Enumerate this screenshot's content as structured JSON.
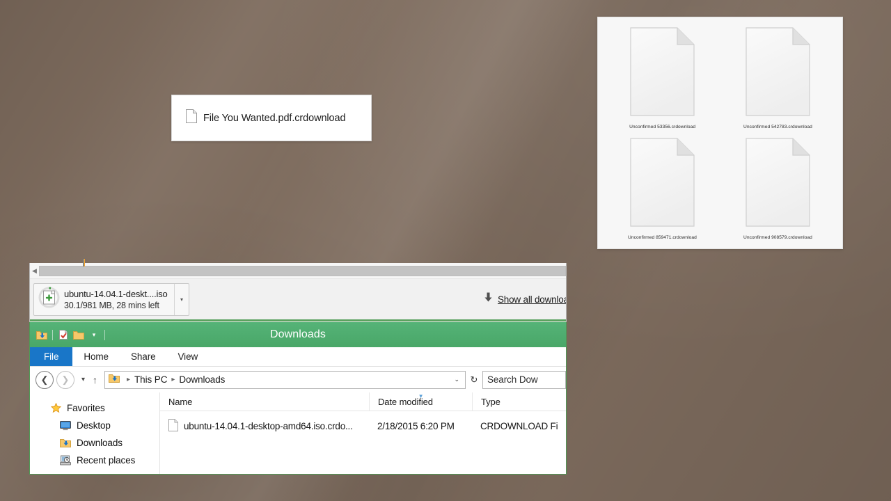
{
  "desktop": {
    "background_color": "#7d6b5d"
  },
  "file_card": {
    "icon": "document-icon",
    "label": "File You Wanted.pdf.crdownload"
  },
  "thumbnail_panel": {
    "items": [
      {
        "icon": "document-icon",
        "label": "Unconfirmed 53356.crdownload"
      },
      {
        "icon": "document-icon",
        "label": "Unconfirmed 542783.crdownload"
      },
      {
        "icon": "document-icon",
        "label": "Unconfirmed 859471.crdownload"
      },
      {
        "icon": "document-icon",
        "label": "Unconfirmed 908579.crdownload"
      }
    ]
  },
  "browser_shelf": {
    "download_item": {
      "icon": "download-progress-icon",
      "filename": "ubuntu-14.04.1-deskt....iso",
      "status": "30.1/981 MB, 28 mins left",
      "menu_caret": "▾"
    },
    "show_all": {
      "icon": "download-arrow-icon",
      "label": "Show all downloads"
    }
  },
  "explorer": {
    "title": "Downloads",
    "accent_color": "#4caf6d",
    "quick_access": [
      {
        "icon": "downloads-folder-icon"
      },
      {
        "icon": "properties-icon"
      },
      {
        "icon": "new-folder-icon"
      },
      {
        "icon": "customize-caret-icon",
        "label": "▾"
      }
    ],
    "ribbon_tabs": [
      {
        "label": "File",
        "active": true
      },
      {
        "label": "Home",
        "active": false
      },
      {
        "label": "Share",
        "active": false
      },
      {
        "label": "View",
        "active": false
      }
    ],
    "navigation": {
      "back": "❮",
      "forward": "❯",
      "history_caret": "▾",
      "up": "↑",
      "breadcrumb_icon": "downloads-folder-icon",
      "breadcrumbs": [
        "This PC",
        "Downloads"
      ],
      "separator": "▸",
      "dropdown_caret": "⌄",
      "refresh": "↻"
    },
    "search": {
      "placeholder": "Search Dow"
    },
    "nav_pane": [
      {
        "icon": "star-icon",
        "label": "Favorites",
        "level": 0
      },
      {
        "icon": "desktop-icon",
        "label": "Desktop",
        "level": 1
      },
      {
        "icon": "downloads-folder-icon",
        "label": "Downloads",
        "level": 1
      },
      {
        "icon": "recent-places-icon",
        "label": "Recent places",
        "level": 1
      }
    ],
    "columns": [
      {
        "label": "Name",
        "sorted": false
      },
      {
        "label": "Date modified",
        "sorted": true
      },
      {
        "label": "Type",
        "sorted": false
      }
    ],
    "rows": [
      {
        "icon": "document-icon",
        "name": "ubuntu-14.04.1-desktop-amd64.iso.crdo...",
        "date": "2/18/2015 6:20 PM",
        "type": "CRDOWNLOAD Fi"
      }
    ]
  }
}
